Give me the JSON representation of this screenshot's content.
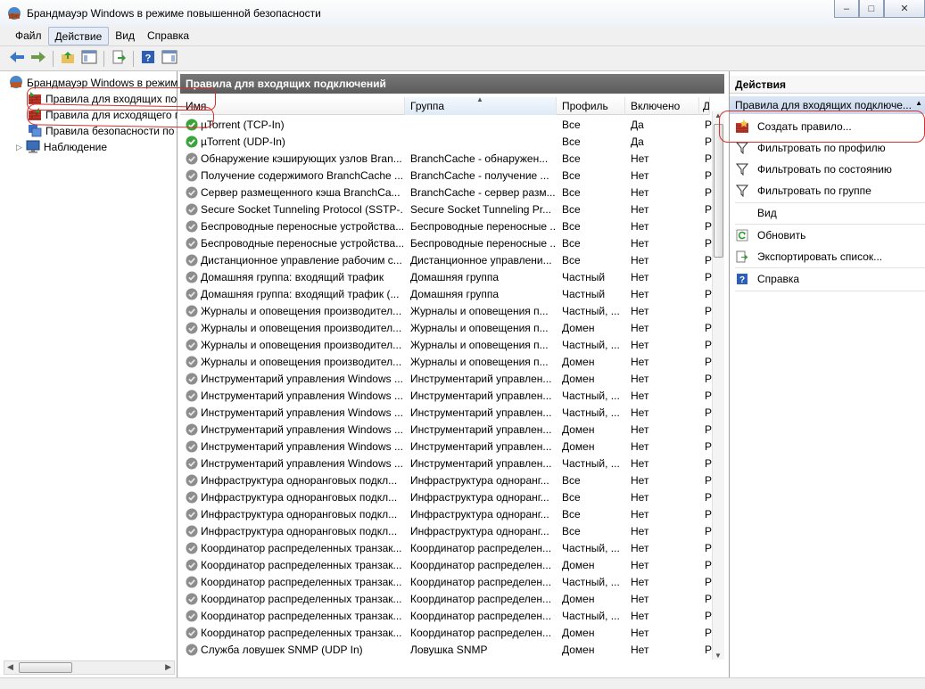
{
  "window": {
    "title": "Брандмауэр Windows в режиме повышенной безопасности"
  },
  "menu": [
    "Файл",
    "Действие",
    "Вид",
    "Справка"
  ],
  "tree": [
    {
      "label": "Брандмауэр Windows в режим",
      "icon": "firewall-icon"
    },
    {
      "label": "Правила для входящих по",
      "icon": "inbound-rules-icon"
    },
    {
      "label": "Правила для исходящего п",
      "icon": "outbound-rules-icon"
    },
    {
      "label": "Правила безопасности по",
      "icon": "security-rules-icon"
    },
    {
      "label": "Наблюдение",
      "icon": "monitoring-icon"
    }
  ],
  "center": {
    "header": "Правила для входящих подключений",
    "columns": [
      "Имя",
      "Группа",
      "Профиль",
      "Включено",
      "Д"
    ],
    "rows": [
      {
        "name": "µTorrent (TCP-In)",
        "group": "",
        "profile": "Все",
        "enabled": "Да",
        "action": "Р",
        "state": "on"
      },
      {
        "name": "µTorrent (UDP-In)",
        "group": "",
        "profile": "Все",
        "enabled": "Да",
        "action": "Р",
        "state": "on"
      },
      {
        "name": "Обнаружение кэширующих узлов Bran...",
        "group": "BranchCache - обнаружен...",
        "profile": "Все",
        "enabled": "Нет",
        "action": "Р",
        "state": "off"
      },
      {
        "name": "Получение содержимого BranchCache ...",
        "group": "BranchCache - получение ...",
        "profile": "Все",
        "enabled": "Нет",
        "action": "Р",
        "state": "off"
      },
      {
        "name": "Сервер размещенного кэша BranchCa...",
        "group": "BranchCache - сервер разм...",
        "profile": "Все",
        "enabled": "Нет",
        "action": "Р",
        "state": "off"
      },
      {
        "name": "Secure Socket Tunneling Protocol (SSTP-...",
        "group": "Secure Socket Tunneling Pr...",
        "profile": "Все",
        "enabled": "Нет",
        "action": "Р",
        "state": "off"
      },
      {
        "name": "Беспроводные переносные устройства...",
        "group": "Беспроводные переносные ...",
        "profile": "Все",
        "enabled": "Нет",
        "action": "Р",
        "state": "off"
      },
      {
        "name": "Беспроводные переносные устройства...",
        "group": "Беспроводные переносные ...",
        "profile": "Все",
        "enabled": "Нет",
        "action": "Р",
        "state": "off"
      },
      {
        "name": "Дистанционное управление рабочим с...",
        "group": "Дистанционное управлени...",
        "profile": "Все",
        "enabled": "Нет",
        "action": "Р",
        "state": "off"
      },
      {
        "name": "Домашняя группа: входящий трафик",
        "group": "Домашняя группа",
        "profile": "Частный",
        "enabled": "Нет",
        "action": "Р",
        "state": "off"
      },
      {
        "name": "Домашняя группа: входящий трафик (...",
        "group": "Домашняя группа",
        "profile": "Частный",
        "enabled": "Нет",
        "action": "Р",
        "state": "off"
      },
      {
        "name": "Журналы и оповещения производител...",
        "group": "Журналы и оповещения п...",
        "profile": "Частный, ...",
        "enabled": "Нет",
        "action": "Р",
        "state": "off"
      },
      {
        "name": "Журналы и оповещения производител...",
        "group": "Журналы и оповещения п...",
        "profile": "Домен",
        "enabled": "Нет",
        "action": "Р",
        "state": "off"
      },
      {
        "name": "Журналы и оповещения производител...",
        "group": "Журналы и оповещения п...",
        "profile": "Частный, ...",
        "enabled": "Нет",
        "action": "Р",
        "state": "off"
      },
      {
        "name": "Журналы и оповещения производител...",
        "group": "Журналы и оповещения п...",
        "profile": "Домен",
        "enabled": "Нет",
        "action": "Р",
        "state": "off"
      },
      {
        "name": "Инструментарий управления Windows ...",
        "group": "Инструментарий управлен...",
        "profile": "Домен",
        "enabled": "Нет",
        "action": "Р",
        "state": "off"
      },
      {
        "name": "Инструментарий управления Windows ...",
        "group": "Инструментарий управлен...",
        "profile": "Частный, ...",
        "enabled": "Нет",
        "action": "Р",
        "state": "off"
      },
      {
        "name": "Инструментарий управления Windows ...",
        "group": "Инструментарий управлен...",
        "profile": "Частный, ...",
        "enabled": "Нет",
        "action": "Р",
        "state": "off"
      },
      {
        "name": "Инструментарий управления Windows ...",
        "group": "Инструментарий управлен...",
        "profile": "Домен",
        "enabled": "Нет",
        "action": "Р",
        "state": "off"
      },
      {
        "name": "Инструментарий управления Windows ...",
        "group": "Инструментарий управлен...",
        "profile": "Домен",
        "enabled": "Нет",
        "action": "Р",
        "state": "off"
      },
      {
        "name": "Инструментарий управления Windows ...",
        "group": "Инструментарий управлен...",
        "profile": "Частный, ...",
        "enabled": "Нет",
        "action": "Р",
        "state": "off"
      },
      {
        "name": "Инфраструктура одноранговых подкл...",
        "group": "Инфраструктура одноранг...",
        "profile": "Все",
        "enabled": "Нет",
        "action": "Р",
        "state": "off"
      },
      {
        "name": "Инфраструктура одноранговых подкл...",
        "group": "Инфраструктура одноранг...",
        "profile": "Все",
        "enabled": "Нет",
        "action": "Р",
        "state": "off"
      },
      {
        "name": "Инфраструктура одноранговых подкл...",
        "group": "Инфраструктура одноранг...",
        "profile": "Все",
        "enabled": "Нет",
        "action": "Р",
        "state": "off"
      },
      {
        "name": "Инфраструктура одноранговых подкл...",
        "group": "Инфраструктура одноранг...",
        "profile": "Все",
        "enabled": "Нет",
        "action": "Р",
        "state": "off"
      },
      {
        "name": "Координатор распределенных транзак...",
        "group": "Координатор распределен...",
        "profile": "Частный, ...",
        "enabled": "Нет",
        "action": "Р",
        "state": "off"
      },
      {
        "name": "Координатор распределенных транзак...",
        "group": "Координатор распределен...",
        "profile": "Домен",
        "enabled": "Нет",
        "action": "Р",
        "state": "off"
      },
      {
        "name": "Координатор распределенных транзак...",
        "group": "Координатор распределен...",
        "profile": "Частный, ...",
        "enabled": "Нет",
        "action": "Р",
        "state": "off"
      },
      {
        "name": "Координатор распределенных транзак...",
        "group": "Координатор распределен...",
        "profile": "Домен",
        "enabled": "Нет",
        "action": "Р",
        "state": "off"
      },
      {
        "name": "Координатор распределенных транзак...",
        "group": "Координатор распределен...",
        "profile": "Частный, ...",
        "enabled": "Нет",
        "action": "Р",
        "state": "off"
      },
      {
        "name": "Координатор распределенных транзак...",
        "group": "Координатор распределен...",
        "profile": "Домен",
        "enabled": "Нет",
        "action": "Р",
        "state": "off"
      },
      {
        "name": "Служба ловушек SNMP (UDP In)",
        "group": "Ловушка SNMP",
        "profile": "Домен",
        "enabled": "Нет",
        "action": "Р",
        "state": "off"
      }
    ]
  },
  "actions": {
    "header": "Действия",
    "subheader": "Правила для входящих подключе...",
    "items": [
      {
        "label": "Создать правило...",
        "icon": "new-rule-icon"
      },
      {
        "label": "Фильтровать по профилю",
        "icon": "filter-icon"
      },
      {
        "label": "Фильтровать по состоянию",
        "icon": "filter-icon"
      },
      {
        "label": "Фильтровать по группе",
        "icon": "filter-icon"
      },
      {
        "label": "Вид",
        "icon": ""
      },
      {
        "label": "Обновить",
        "icon": "refresh-icon"
      },
      {
        "label": "Экспортировать список...",
        "icon": "export-icon"
      },
      {
        "label": "Справка",
        "icon": "help-icon"
      }
    ]
  },
  "colors": {
    "annotation_red": "#d3302e",
    "enabled_green": "#3aa33a",
    "disabled_gray": "#8d8d8d"
  }
}
